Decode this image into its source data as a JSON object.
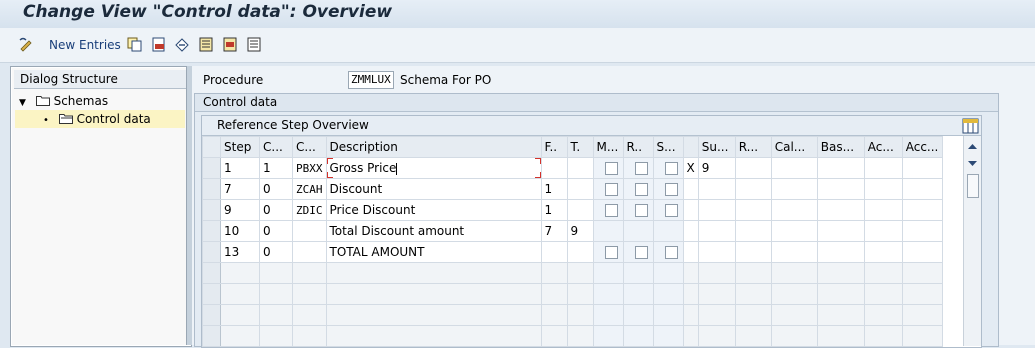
{
  "window": {
    "title": "Change View \"Control data\": Overview"
  },
  "toolbar": {
    "new_entries_label": "New Entries"
  },
  "dialog_structure": {
    "header": "Dialog Structure",
    "items": [
      {
        "label": "Schemas"
      },
      {
        "label": "Control data"
      }
    ]
  },
  "procedure": {
    "label": "Procedure",
    "value": "ZMMLUX",
    "description": "Schema For PO"
  },
  "control_tab": {
    "label": "Control data"
  },
  "step_overview": {
    "title": "Reference Step Overview",
    "columns": [
      "Step",
      "C...",
      "C...",
      "Description",
      "F..",
      "T.",
      "M...",
      "R..",
      "S...",
      "",
      "Su...",
      "R...",
      "Cal...",
      "Bas...",
      "Ac...",
      "Acc..."
    ],
    "rows": [
      {
        "step": "1",
        "counter": "1",
        "cond_type": "PBXX",
        "description": "Gross Price",
        "from": "",
        "to": "",
        "flag": "X",
        "subtotal": "9"
      },
      {
        "step": "7",
        "counter": "0",
        "cond_type": "ZCAH",
        "description": "Discount",
        "from": "1",
        "to": "",
        "flag": "",
        "subtotal": ""
      },
      {
        "step": "9",
        "counter": "0",
        "cond_type": "ZDIC",
        "description": "Price Discount",
        "from": "1",
        "to": "",
        "flag": "",
        "subtotal": ""
      },
      {
        "step": "10",
        "counter": "0",
        "cond_type": "",
        "description": "Total Discount amount",
        "from": "7",
        "to": "9",
        "flag": "",
        "subtotal": ""
      },
      {
        "step": "13",
        "counter": "0",
        "cond_type": "",
        "description": "TOTAL AMOUNT",
        "from": "",
        "to": "",
        "flag": "",
        "subtotal": ""
      }
    ]
  }
}
